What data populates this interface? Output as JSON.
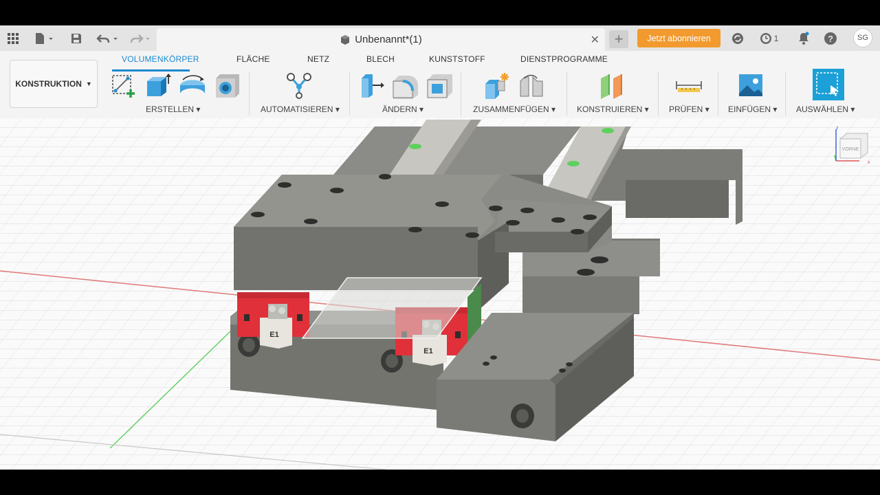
{
  "document": {
    "title": "Unbenannt*(1)"
  },
  "appbar": {
    "subscribe_label": "Jetzt abonnieren",
    "job_count": "1",
    "user_initials": "SG"
  },
  "ribbon": {
    "workspace_label": "KONSTRUKTION",
    "tabs": [
      "VOLUMENKÖRPER",
      "FLÄCHE",
      "NETZ",
      "BLECH",
      "KUNSTSTOFF",
      "DIENSTPROGRAMME"
    ],
    "active_tab": "VOLUMENKÖRPER",
    "groups": [
      {
        "label": "ERSTELLEN"
      },
      {
        "label": "AUTOMATISIEREN"
      },
      {
        "label": "ÄNDERN"
      },
      {
        "label": "ZUSAMMENFÜGEN"
      },
      {
        "label": "KONSTRUIEREN"
      },
      {
        "label": "PRÜFEN"
      },
      {
        "label": "EINFÜGEN"
      },
      {
        "label": "AUSWÄHLEN"
      }
    ]
  },
  "viewport": {
    "block_label": "E1",
    "viewcube_label": "VORNE",
    "axis_colors": {
      "x": "#e05555",
      "y": "#55cc55",
      "z": "#4a6fd8"
    }
  },
  "colors": {
    "accent": "#1b8ad0",
    "subscribe": "#f29a2e",
    "carriage_red": "#e0303a",
    "part_gray": "#8a8a86"
  }
}
